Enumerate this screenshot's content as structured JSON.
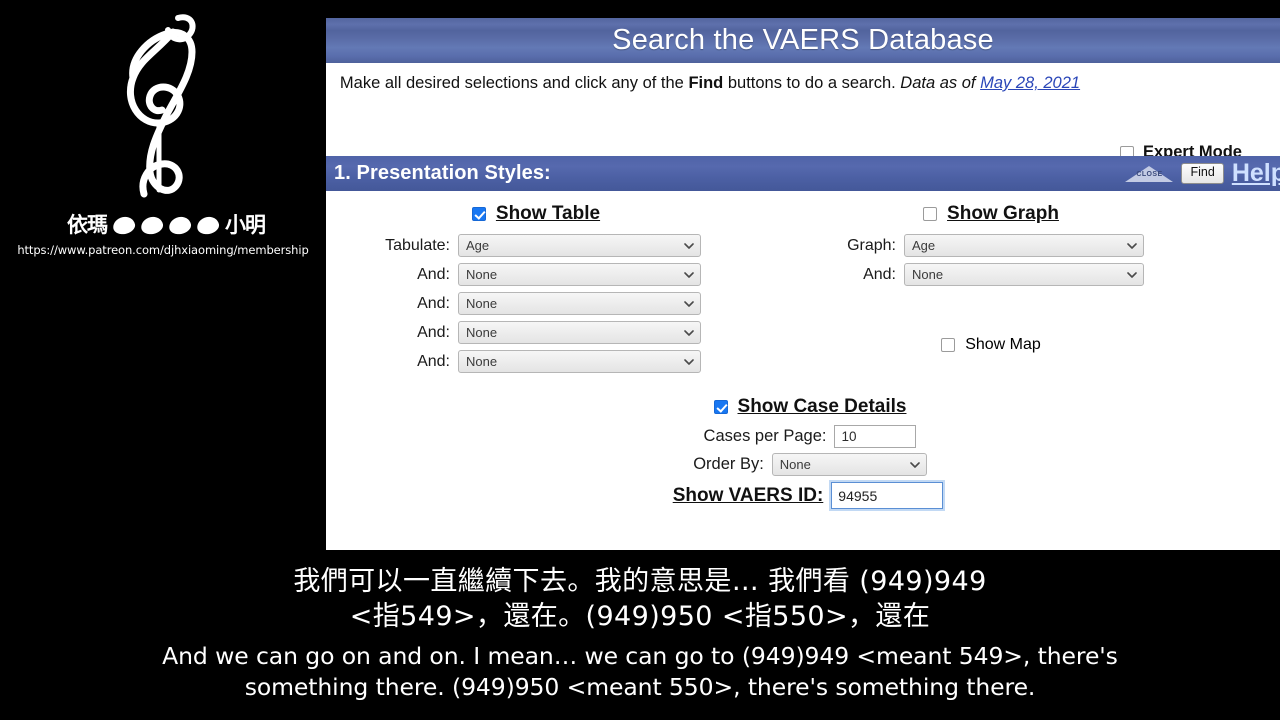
{
  "logo": {
    "mark_name": "treble-clef-dj-monogram",
    "brush_left": "依瑪",
    "brush_right": "小明",
    "url": "https://www.patreon.com/djhxiaoming/membership"
  },
  "page": {
    "title": "Search the VAERS Database",
    "intro_part1": "Make all desired selections and click any of the ",
    "intro_bold": "Find",
    "intro_part2": " buttons to do a search. ",
    "intro_italic": "Data as of ",
    "date_link": "May 28, 2021",
    "expert_mode_label": "Expert Mode",
    "expert_mode_checked": false
  },
  "section": {
    "heading": "1. Presentation Styles:",
    "close_label": "CLOSE",
    "find_label": "Find",
    "help_label": "Help"
  },
  "show_table": {
    "label": "Show Table",
    "checked": true,
    "rows": [
      {
        "label": "Tabulate:",
        "value": "Age"
      },
      {
        "label": "And:",
        "value": "None"
      },
      {
        "label": "And:",
        "value": "None"
      },
      {
        "label": "And:",
        "value": "None"
      },
      {
        "label": "And:",
        "value": "None"
      }
    ]
  },
  "show_graph": {
    "label": "Show Graph",
    "checked": false,
    "rows": [
      {
        "label": "Graph:",
        "value": "Age"
      },
      {
        "label": "And:",
        "value": "None"
      }
    ]
  },
  "show_map": {
    "label": "Show Map",
    "checked": false
  },
  "case_details": {
    "label": "Show Case Details",
    "checked": true,
    "cases_per_page_label": "Cases per Page:",
    "cases_per_page_value": "10",
    "order_by_label": "Order By:",
    "order_by_value": "None"
  },
  "vaers_id": {
    "label": "Show VAERS ID:",
    "value": "94955"
  },
  "subtitles": {
    "zh_line1": "我們可以一直繼續下去。我的意思是… 我們看 (949)949",
    "zh_line2": "<指549>，還在。(949)950 <指550>，還在",
    "en_line1": "And we can go on and on. I mean… we can go to (949)949 <meant 549>, there's",
    "en_line2": "something there. (949)950 <meant 550>, there's something there."
  },
  "colors": {
    "title_bar_blue": "#5769aa",
    "section_bar_blue": "#4d61a5",
    "link_blue": "#2a46b8",
    "checkbox_blue": "#1877f2",
    "focus_ring_blue": "#5b8fd4"
  }
}
